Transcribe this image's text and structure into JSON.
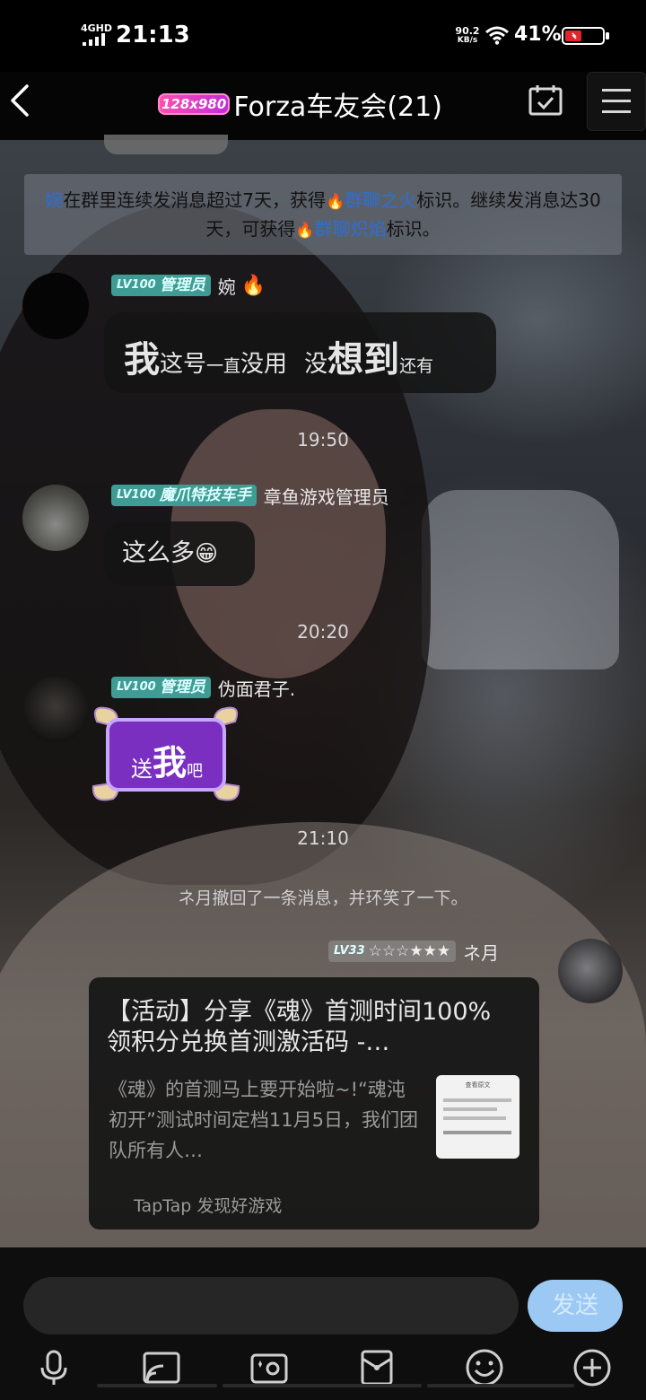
{
  "status_bar": {
    "network": "4GHD",
    "time": "21:13",
    "speed_value": "90.2",
    "speed_unit": "KB/s",
    "battery": "41%"
  },
  "header": {
    "group_badge": "128x980",
    "title": "Forza车友会(21)"
  },
  "notice": {
    "user": "婉",
    "text1": "在群里连续发消息超过7天，获得",
    "fire_glyph": "🔥",
    "badge1": "群聊之火",
    "text2": "标识。继续发消息达30天，可获得",
    "badge2": "群聊炽焰",
    "text3": "标识。"
  },
  "messages": [
    {
      "level_tag": "LV100",
      "role": "管理员",
      "nick": "婉",
      "nick_icon": "🔥",
      "parts": [
        "我",
        "这号",
        "一直",
        "没用",
        "没",
        "想到",
        "还有"
      ]
    },
    {
      "time": "19:50",
      "level_tag": "LV100",
      "role": "魔爪特技车手",
      "nick": "章鱼游戏管理员",
      "text": "这么多",
      "emoji": "😁"
    },
    {
      "time": "20:20",
      "level_tag": "LV100",
      "role": "管理员",
      "nick": "伪面君子.",
      "sticker_small1": "送",
      "sticker_big": "我",
      "sticker_small2": "吧"
    }
  ],
  "time_2110": "21:10",
  "recall_notice": "ネ月撤回了一条消息，并环笑了一下。",
  "self_message": {
    "level_tag": "LV33",
    "stars": "☆☆☆★★★",
    "nick": "ネ月"
  },
  "link_card": {
    "title": "【活动】分享《魂》首测时间100%领积分兑换首测激活码 -…",
    "description": "《魂》的首测马上要开始啦~!“魂沌初开”测试时间定档11月5日，我们团队所有人…",
    "thumb_heading": "查看原文",
    "source": "TapTap 发现好游戏"
  },
  "input_bar": {
    "send_label": "发送"
  },
  "toolbar": [
    "mic-icon",
    "screen-cast-icon",
    "photo-icon",
    "red-packet-icon",
    "emoji-icon",
    "plus-icon"
  ],
  "colors": {
    "accent_blue": "#2c6fd6",
    "level_badge": "#3f9c94",
    "send_button": "#9cc9f4",
    "fire": "#ff5a1f"
  }
}
